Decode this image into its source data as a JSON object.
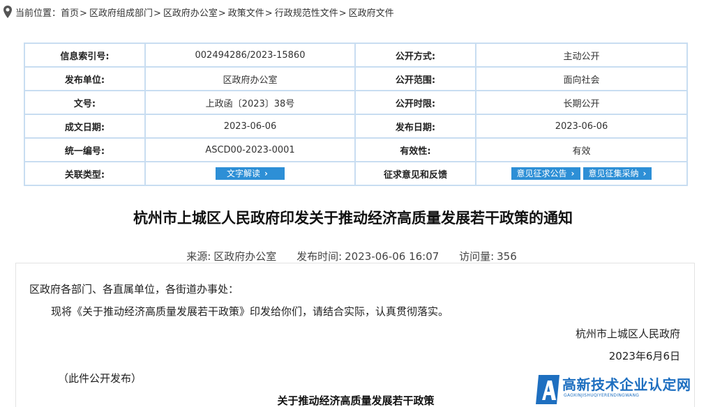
{
  "breadcrumb": {
    "prefix": "当前位置：",
    "items": [
      "首页",
      "区政府组成部门",
      "区政府办公室",
      "政策文件",
      "行政规范性文件",
      "区政府文件"
    ],
    "separator": ">"
  },
  "info_table": {
    "rows": [
      {
        "l1": "信息索引号:",
        "v1": "002494286/2023-15860",
        "l2": "公开方式:",
        "v2": "主动公开"
      },
      {
        "l1": "发布单位:",
        "v1": "区政府办公室",
        "l2": "公开范围:",
        "v2": "面向社会"
      },
      {
        "l1": "文号:",
        "v1": "上政函〔2023〕38号",
        "l2": "公开时限:",
        "v2": "长期公开"
      },
      {
        "l1": "成文日期:",
        "v1": "2023-06-06",
        "l2": "发布日期:",
        "v2": "2023-06-06"
      },
      {
        "l1": "统一编号:",
        "v1": "ASCD00-2023-0001",
        "l2": "有效性:",
        "v2": "有效"
      }
    ],
    "last_row": {
      "l1": "关联类型:",
      "button1": "文字解读",
      "l2": "征求意见和反馈",
      "button2": "意见征求公告",
      "button3": "意见征集采纳"
    }
  },
  "article": {
    "title": "杭州市上城区人民政府印发关于推动经济高质量发展若干政策的通知",
    "source_label": "来源:",
    "source": "区政府办公室",
    "time_label": "发布时间:",
    "time": "2023-06-06 16:07",
    "views_label": "访问量:",
    "views": "356",
    "greeting": "区政府各部门、各直属单位，各街道办事处：",
    "body": "现将《关于推动经济高质量发展若干政策》印发给你们，请结合实际，认真贯彻落实。",
    "signature": "杭州市上城区人民政府",
    "date": "2023年6月6日",
    "note": "（此件公开发布）",
    "subtitle": "关于推动经济高质量发展若干政策"
  },
  "watermark": {
    "text": "高新技术企业认定网",
    "sub": "GAOXINJISHUQIYERENDINGWANG",
    "color": "#1e6fc0"
  },
  "colors": {
    "border": "#c8ddf1",
    "button": "#2d8fd6"
  }
}
